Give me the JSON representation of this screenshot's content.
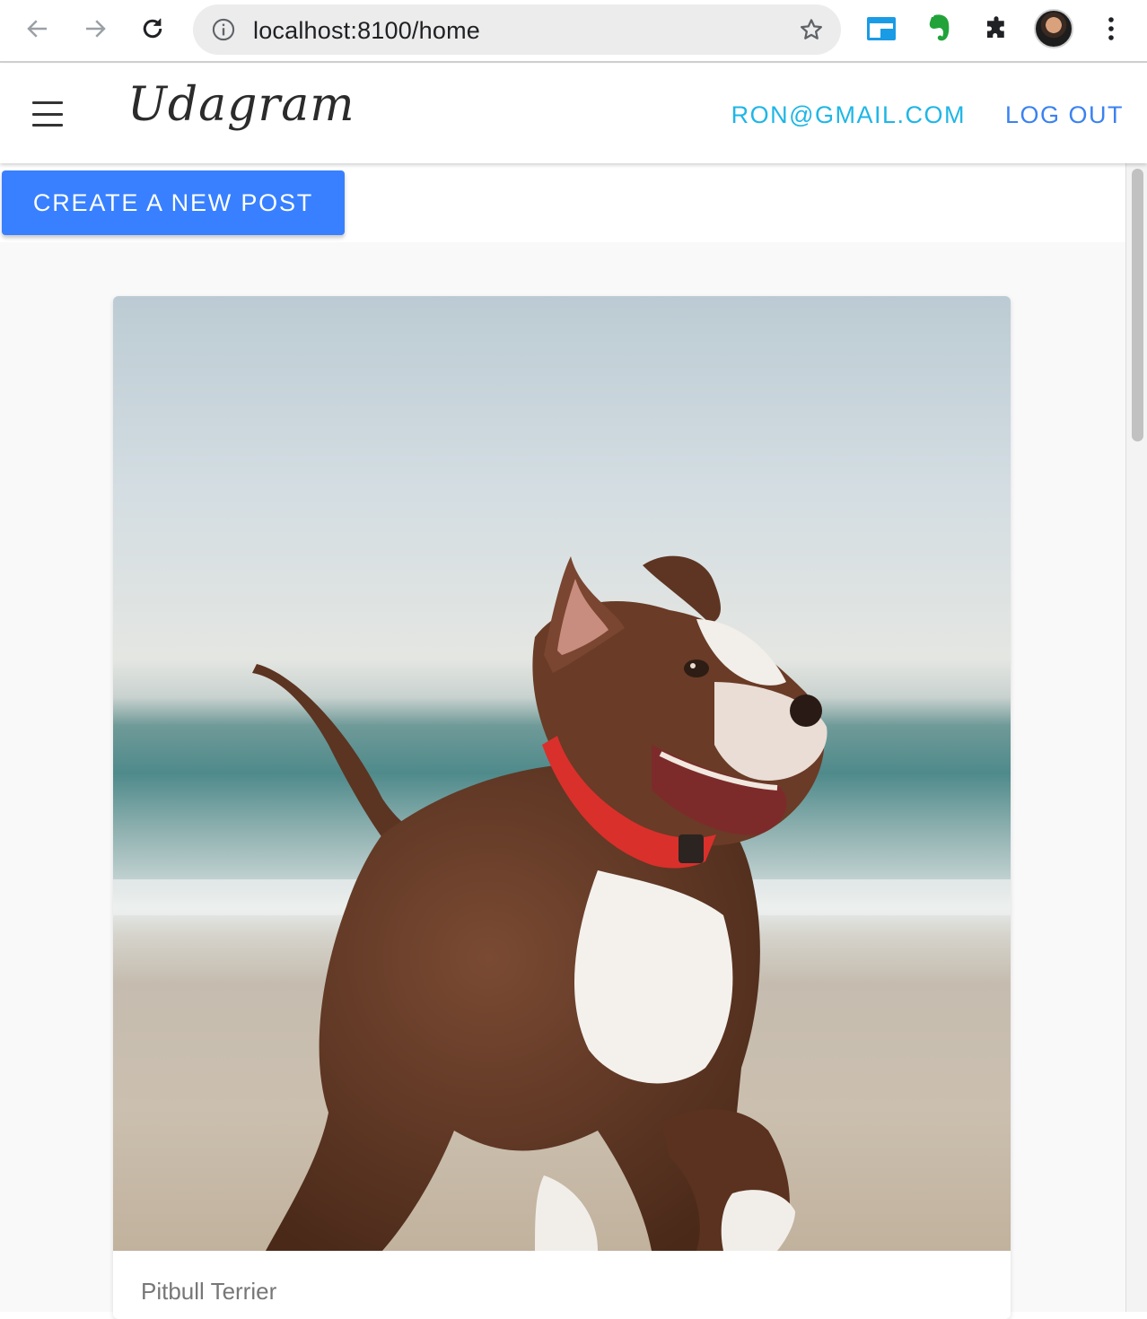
{
  "browser": {
    "url": "localhost:8100/home",
    "icons": {
      "back": "arrow-left-icon",
      "forward": "arrow-right-icon",
      "reload": "reload-icon",
      "info": "info-icon",
      "bookmark": "star-icon",
      "extension_1": "tab-window-icon",
      "extension_2": "evernote-elephant-icon",
      "extensions": "puzzle-icon",
      "menu": "more-vert-icon"
    }
  },
  "header": {
    "brand": "Udagram",
    "user_email": "RON@GMAIL.COM",
    "logout_label": "LOG OUT"
  },
  "actions": {
    "create_post_label": "CREATE A NEW POST"
  },
  "feed": {
    "items": [
      {
        "caption": "Pitbull Terrier"
      }
    ]
  },
  "colors": {
    "primary": "#3880ff",
    "email": "#1fb6e6",
    "logout": "#3b82f0"
  }
}
